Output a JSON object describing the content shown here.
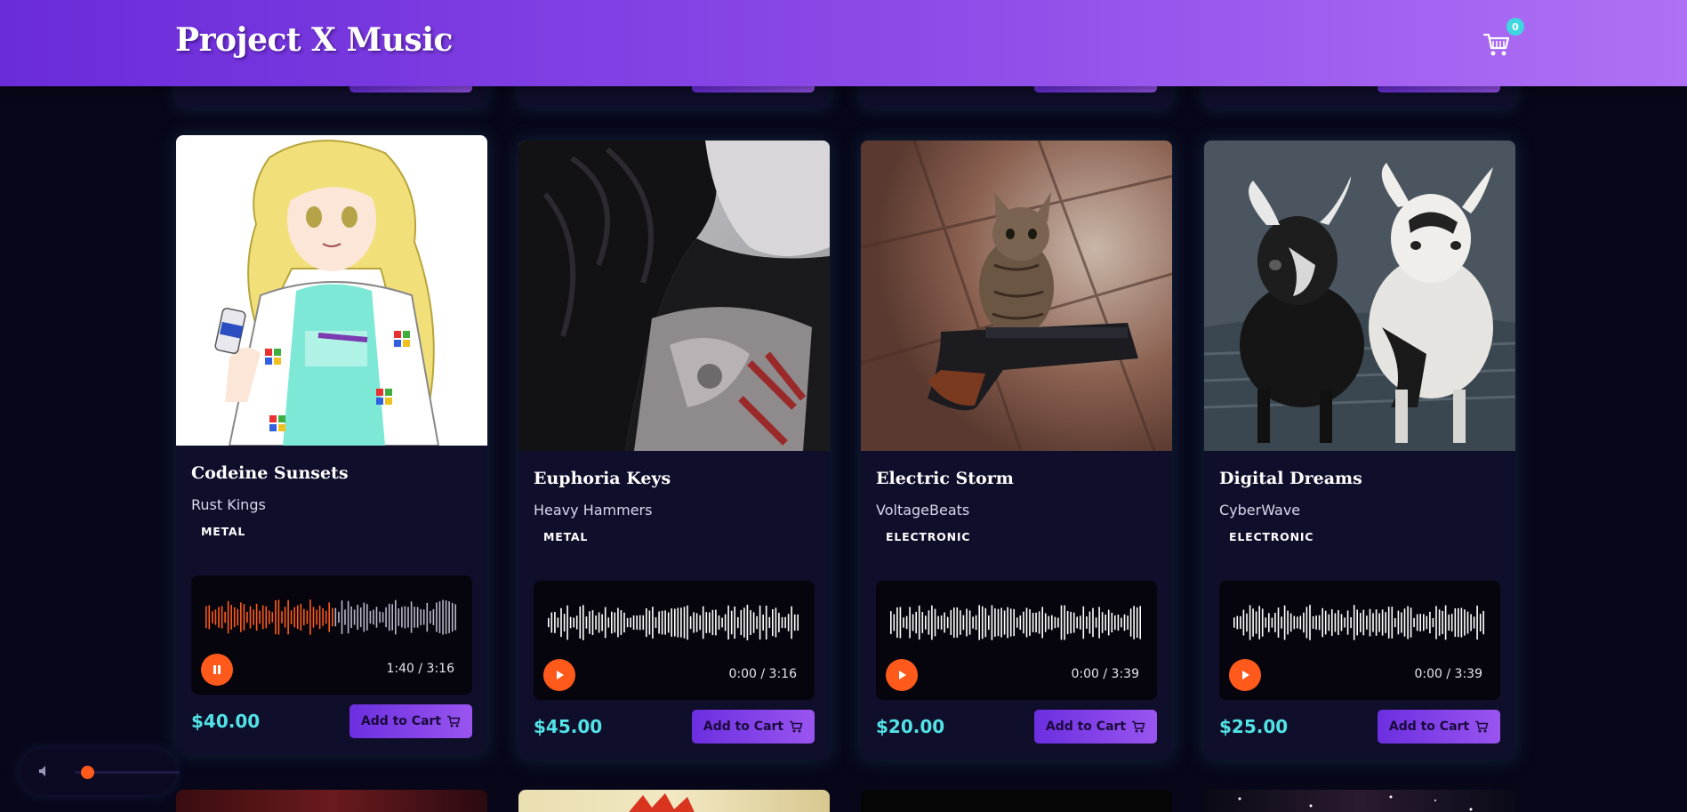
{
  "header": {
    "brand": "Project X Music",
    "cart_count": "0",
    "cart_icon": "cart-icon"
  },
  "cards": [
    {
      "title": "Codeine Sunsets",
      "artist": "Rust Kings",
      "genre": "METAL",
      "time": "1:40 / 3:16",
      "playing": true,
      "progress": 0.51,
      "price": "$40.00",
      "add_label": "Add to Cart",
      "art": "anime-girl-soda-can"
    },
    {
      "title": "Euphoria Keys",
      "artist": "Heavy Hammers",
      "genre": "METAL",
      "time": "0:00 / 3:16",
      "playing": false,
      "progress": 0,
      "price": "$45.00",
      "add_label": "Add to Cart",
      "art": "dark-hair-figure-shirt"
    },
    {
      "title": "Electric Storm",
      "artist": "VoltageBeats",
      "genre": "ELECTRONIC",
      "time": "0:00 / 3:39",
      "playing": false,
      "progress": 0,
      "price": "$20.00",
      "add_label": "Add to Cart",
      "art": "kitten-with-pistol"
    },
    {
      "title": "Digital Dreams",
      "artist": "CyberWave",
      "genre": "ELECTRONIC",
      "time": "0:00 / 3:39",
      "playing": false,
      "progress": 0,
      "price": "$25.00",
      "add_label": "Add to Cart",
      "art": "two-baby-goats"
    }
  ],
  "volume": {
    "icon": "speaker-icon",
    "level": 0.12
  },
  "colors": {
    "accent": "#ff5a1c",
    "price": "#52e3e6",
    "header_start": "#6a2bd9",
    "header_end": "#b070f5",
    "background": "#08071a",
    "card": "#0f0e2b"
  }
}
